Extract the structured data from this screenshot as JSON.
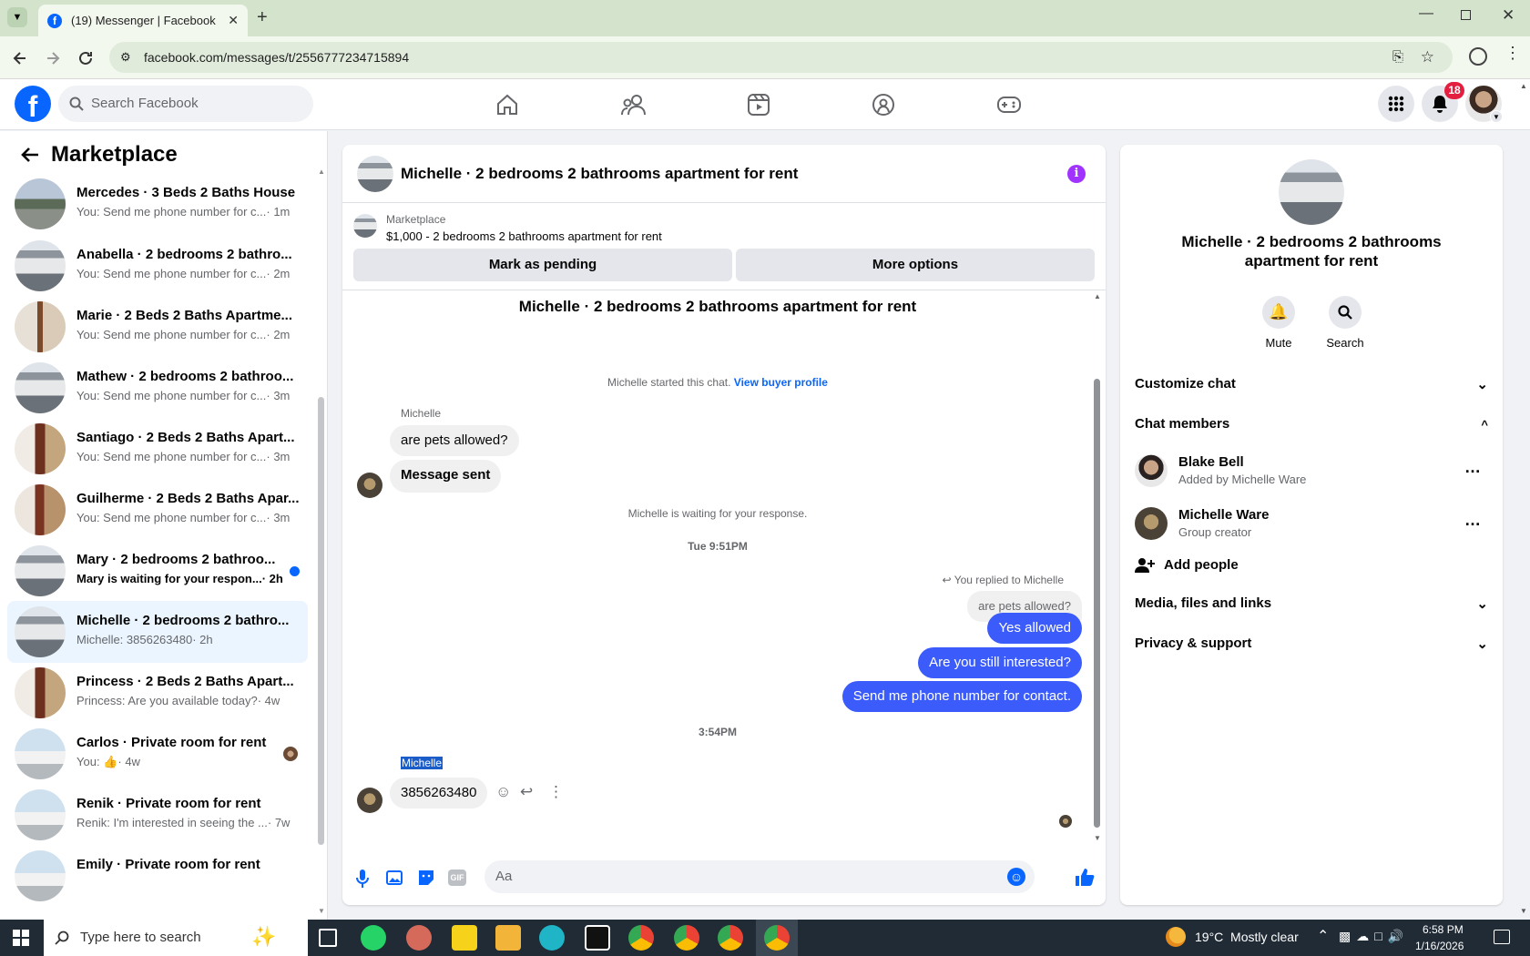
{
  "browser": {
    "tab_title": "(19) Messenger | Facebook",
    "url": "facebook.com/messages/t/2556777234715894"
  },
  "header": {
    "search_placeholder": "Search Facebook",
    "notification_count": "18"
  },
  "left": {
    "title": "Marketplace",
    "conversations": [
      {
        "title": "Mercedes · 3 Beds 2 Baths House",
        "preview": "You: Send me phone number for c...",
        "time": "· 1m"
      },
      {
        "title": "Anabella · 2 bedrooms 2 bathro...",
        "preview": "You: Send me phone number for c...",
        "time": "· 2m"
      },
      {
        "title": "Marie · 2 Beds 2 Baths Apartme...",
        "preview": "You: Send me phone number for c...",
        "time": "· 2m"
      },
      {
        "title": "Mathew · 2 bedrooms 2 bathroo...",
        "preview": "You: Send me phone number for c...",
        "time": "· 3m"
      },
      {
        "title": "Santiago · 2 Beds 2 Baths Apart...",
        "preview": "You: Send me phone number for c...",
        "time": "· 3m"
      },
      {
        "title": "Guilherme · 2 Beds 2 Baths Apar...",
        "preview": "You: Send me phone number for c...",
        "time": "· 3m"
      },
      {
        "title": "Mary · 2 bedrooms 2 bathroo...",
        "preview": "Mary is waiting for your respon...",
        "time": "· 2h"
      },
      {
        "title": "Michelle · 2 bedrooms 2 bathro...",
        "preview": "Michelle: 3856263480",
        "time": "· 2h"
      },
      {
        "title": "Princess · 2 Beds 2 Baths Apart...",
        "preview": "Princess: Are you available today?",
        "time": "· 4w"
      },
      {
        "title": "Carlos · Private room for rent",
        "preview": "You:",
        "time": "· 4w"
      },
      {
        "title": "Renik · Private room for rent",
        "preview": "Renik: I'm interested in seeing the ...",
        "time": "· 7w"
      },
      {
        "title": "Emily · Private room for rent",
        "preview": "",
        "time": ""
      }
    ]
  },
  "chat": {
    "title": "Michelle · 2 bedrooms 2 bathrooms apartment for rent",
    "listing_source": "Marketplace",
    "listing_line": "$1,000 - 2 bedrooms 2 bathrooms apartment for rent",
    "mark_pending": "Mark as pending",
    "more_options": "More options",
    "thread_heading": "Michelle · 2 bedrooms 2 bathrooms apartment for rent",
    "started_text": "Michelle started this chat.",
    "buyer_profile_link": "View buyer profile",
    "sender1": "Michelle",
    "msg_pets": "are pets allowed?",
    "msg_sent": "Message sent",
    "waiting_text": "Michelle is waiting for your response.",
    "time1": "Tue 9:51PM",
    "replied_to": "You replied to Michelle",
    "quoted": "are pets allowed?",
    "out1": "Yes allowed",
    "out2": "Are you still interested?",
    "out3": "Send me phone number for contact.",
    "time2": "3:54PM",
    "sender2": "Michelle",
    "msg_phone": "3856263480",
    "composer_placeholder": "Aa"
  },
  "info": {
    "title": "Michelle · 2 bedrooms 2 bathrooms apartment for rent",
    "mute": "Mute",
    "search": "Search",
    "customize": "Customize chat",
    "members_header": "Chat members",
    "members": [
      {
        "name": "Blake Bell",
        "sub": "Added by Michelle Ware"
      },
      {
        "name": "Michelle Ware",
        "sub": "Group creator"
      }
    ],
    "add_people": "Add people",
    "media": "Media, files and links",
    "privacy": "Privacy & support"
  },
  "taskbar": {
    "search_placeholder": "Type here to search",
    "weather": "19°C  Mostly clear",
    "time": "6:58 PM",
    "date": "1/16/2026"
  },
  "colors": {
    "fb_blue": "#0866ff",
    "outgoing": "#3b5bfa",
    "info_purple": "#a033ff"
  }
}
